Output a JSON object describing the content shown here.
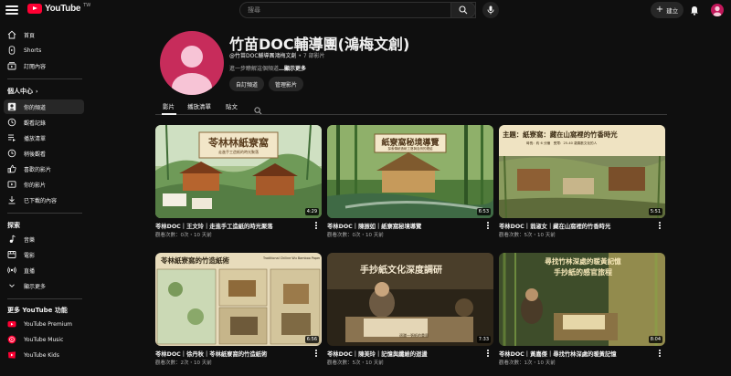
{
  "header": {
    "logo_text": "YouTube",
    "logo_region": "TW",
    "search_placeholder": "搜尋",
    "create_label": "建立"
  },
  "sidebar": {
    "main_items": [
      {
        "label": "首頁",
        "icon": "home-icon"
      },
      {
        "label": "Shorts",
        "icon": "shorts-icon"
      },
      {
        "label": "訂閱內容",
        "icon": "subscriptions-icon"
      }
    ],
    "you_heading": "個人中心",
    "you_items": [
      {
        "label": "你的頻道",
        "icon": "your-channel-icon"
      },
      {
        "label": "觀看記錄",
        "icon": "history-icon"
      },
      {
        "label": "播放清單",
        "icon": "playlists-icon"
      },
      {
        "label": "稍後觀看",
        "icon": "watch-later-icon"
      },
      {
        "label": "喜歡的影片",
        "icon": "liked-icon"
      },
      {
        "label": "你的影片",
        "icon": "your-videos-icon"
      },
      {
        "label": "已下載的內容",
        "icon": "downloads-icon"
      }
    ],
    "explore_heading": "探索",
    "explore_items": [
      {
        "label": "音樂",
        "icon": "music-icon"
      },
      {
        "label": "電影",
        "icon": "movies-icon"
      },
      {
        "label": "直播",
        "icon": "live-icon"
      },
      {
        "label": "顯示更多",
        "icon": "chevron-down-icon"
      }
    ],
    "more_heading": "更多 YouTube 功能",
    "more_items": [
      {
        "label": "YouTube Premium",
        "icon": "youtube-premium-icon"
      },
      {
        "label": "YouTube Music",
        "icon": "youtube-music-icon"
      },
      {
        "label": "YouTube Kids",
        "icon": "youtube-kids-icon"
      }
    ]
  },
  "channel": {
    "name": "竹苗DOC輔導團(鴻梅文創)",
    "handle": "@竹苗DOC輔導團鴻梅文創",
    "video_count": " • 7 部影片",
    "description": "進一步瞭解這個頻道",
    "show_more": "…顯示更多",
    "customize_button": "自訂頻道",
    "manage_button": "管理影片"
  },
  "tabs": [
    "影片",
    "播放清單",
    "貼文"
  ],
  "videos": [
    {
      "title": "苓林DOC｜王文玲｜走進手工造紙的時光聚落",
      "meta": "觀看次數：0次・10 天前",
      "duration": "4:29",
      "thumb_text": "苓林林紙寮窩",
      "thumb_sub": "走進手工造紙的時光聚落"
    },
    {
      "title": "苓林DOC｜陳振如｜紙寮窩秘境導覽",
      "meta": "觀看次數：0次・10 天前",
      "duration": "6:53",
      "thumb_text": "紙寮窩秘境導覽",
      "thumb_sub": "探索傳統造紙工藝與自然的連結"
    },
    {
      "title": "苓林DOC｜翁淑女｜藏在山窩裡的竹香時光",
      "meta": "觀看次數：5次・10 天前",
      "duration": "5:51",
      "thumb_text": "主題：紙寮窩：藏在山窩裡的竹香時光",
      "thumb_sub": "時長：約 6 分鐘　受眾：25-40 歲喜歡文化的人"
    },
    {
      "title": "苓林DOC｜徐丹秋｜苓林紙寮窩的竹造紙術",
      "meta": "觀看次數：2次・10 天前",
      "duration": "6:56",
      "thumb_text": "苓林紙寮窩的竹造紙術",
      "thumb_sub": "Traditional Chiline Wu Bamboo Papermaking Art"
    },
    {
      "title": "苓林DOC｜陳美玲｜記憶與纖維的迴盪",
      "meta": "觀看次數：5次・10 天前",
      "duration": "7:33",
      "thumb_text": "手抄紙文化深度調研",
      "thumb_sub": "迴盪一張紙的重量"
    },
    {
      "title": "苓林DOC｜黃嘉傑｜尋找竹林深處的暖黃記憶",
      "meta": "觀看次數：1次・10 天前",
      "duration": "8:04",
      "thumb_text": "尋找竹林深處的暖黃記憶",
      "thumb_sub": "手抄紙的感官旅程"
    }
  ]
}
